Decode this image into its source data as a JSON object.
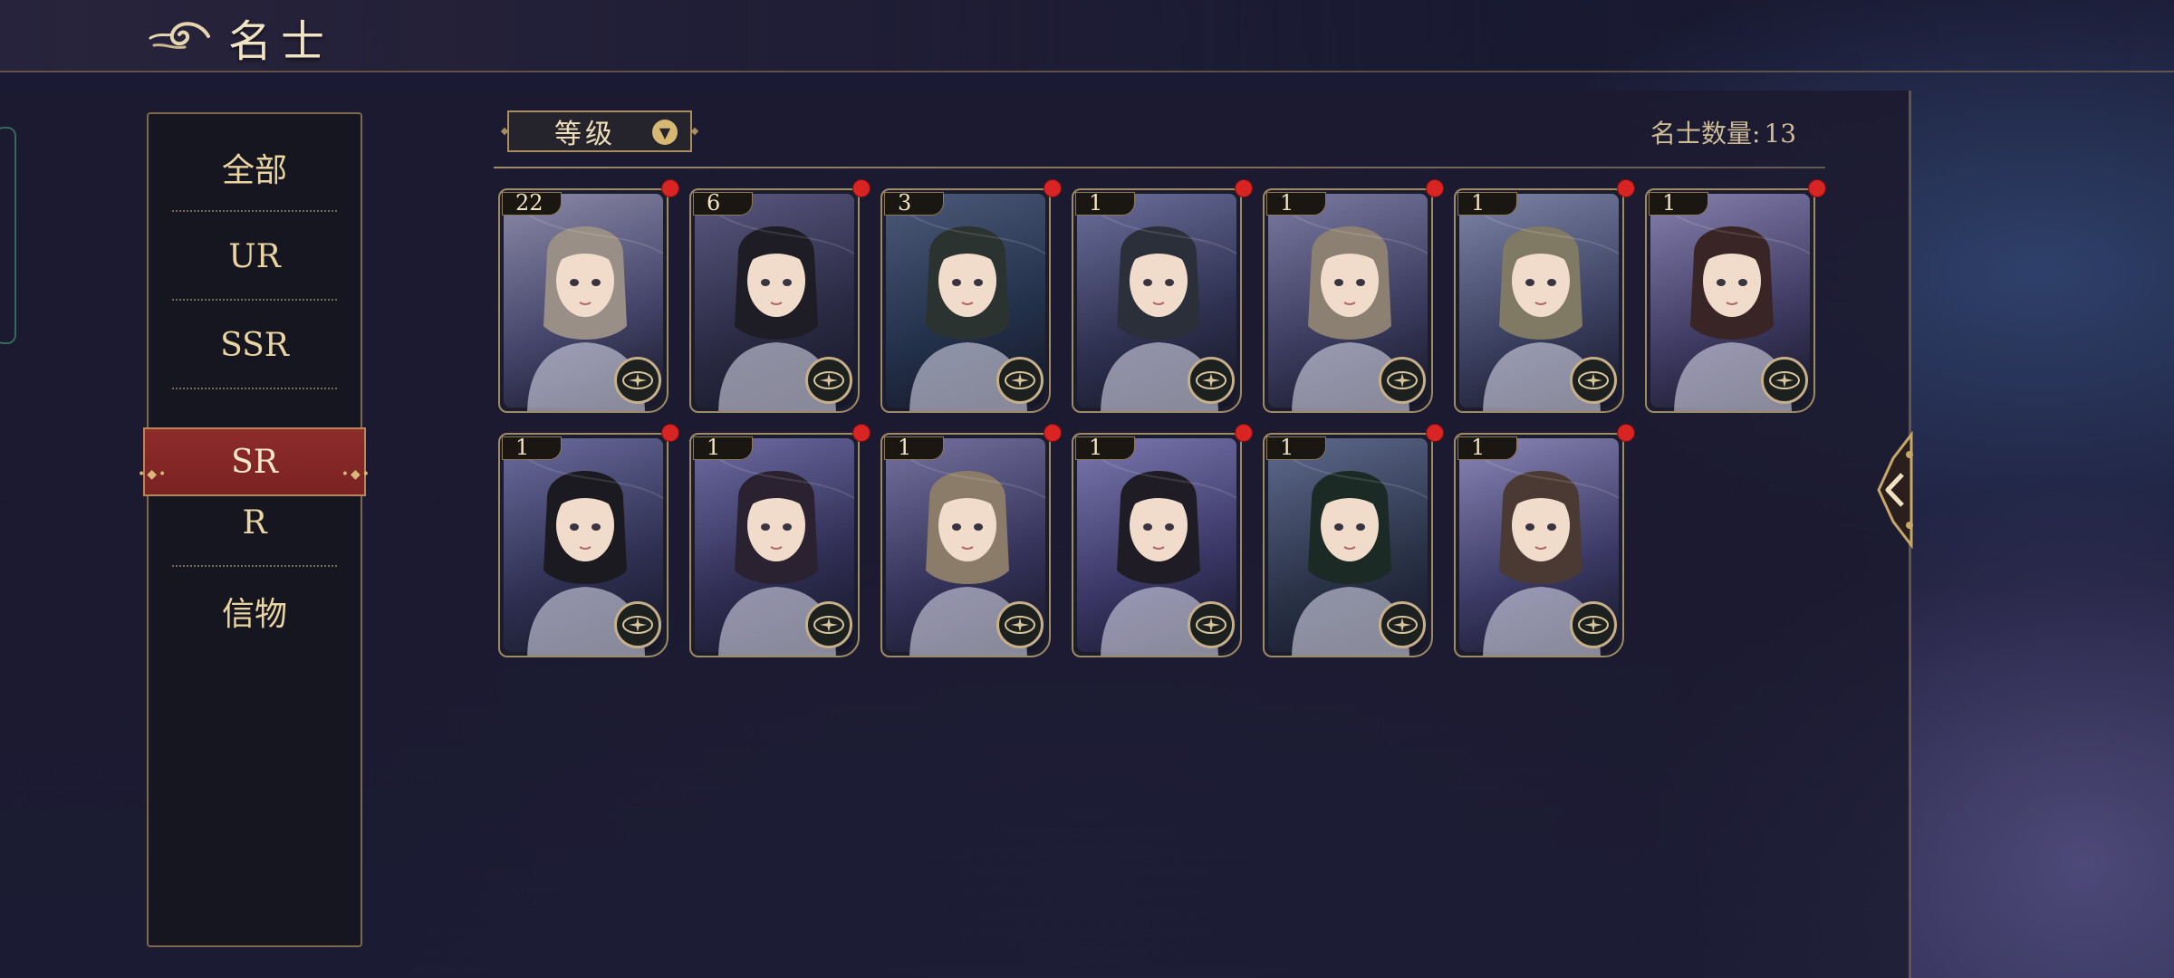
{
  "header": {
    "title": "名士",
    "swirl_icon": "cloud-swirl-icon"
  },
  "sidebar": {
    "items": [
      {
        "label": "全部",
        "active": false
      },
      {
        "label": "UR",
        "active": false
      },
      {
        "label": "SSR",
        "active": false
      },
      {
        "label": "SR",
        "active": true
      },
      {
        "label": "R",
        "active": false
      },
      {
        "label": "信物",
        "active": false
      }
    ]
  },
  "toolbar": {
    "sort_label": "等级",
    "count_label": "名士数量:",
    "count_value": "13"
  },
  "cards": [
    {
      "level": "22",
      "new": true,
      "c1": "#8b8aa8",
      "c2": "#44446a",
      "hair": "#9a8f86"
    },
    {
      "level": "6",
      "new": true,
      "c1": "#5a5880",
      "c2": "#2a2a44",
      "hair": "#1e1c24"
    },
    {
      "level": "3",
      "new": true,
      "c1": "#4c5a7a",
      "c2": "#23304a",
      "hair": "#2a3330"
    },
    {
      "level": "1",
      "new": true,
      "c1": "#6c6f9c",
      "c2": "#2e3150",
      "hair": "#2b2f3a"
    },
    {
      "level": "1",
      "new": true,
      "c1": "#7b7aa2",
      "c2": "#3b3b5e",
      "hair": "#8c8073"
    },
    {
      "level": "1",
      "new": true,
      "c1": "#7d84a6",
      "c2": "#3b4060",
      "hair": "#807a64"
    },
    {
      "level": "1",
      "new": true,
      "c1": "#8580ad",
      "c2": "#3e3a62",
      "hair": "#3a2526"
    },
    {
      "level": "1",
      "new": true,
      "c1": "#6b6c9e",
      "c2": "#2f3052",
      "hair": "#1a1a20"
    },
    {
      "level": "1",
      "new": true,
      "c1": "#6e6ca4",
      "c2": "#302e54",
      "hair": "#2a2230"
    },
    {
      "level": "1",
      "new": true,
      "c1": "#7572a0",
      "c2": "#35335a",
      "hair": "#8a7c68"
    },
    {
      "level": "1",
      "new": true,
      "c1": "#7b78b0",
      "c2": "#3a3766",
      "hair": "#1f1c26"
    },
    {
      "level": "1",
      "new": true,
      "c1": "#5f6a8e",
      "c2": "#2a3348",
      "hair": "#1b2a24"
    },
    {
      "level": "1",
      "new": true,
      "c1": "#8a86b6",
      "c2": "#3c3a66",
      "hair": "#4a3a33"
    }
  ],
  "colors": {
    "accent_gold": "#d7b873",
    "active_tab": "#8e2b2b",
    "new_dot": "#d92424"
  }
}
